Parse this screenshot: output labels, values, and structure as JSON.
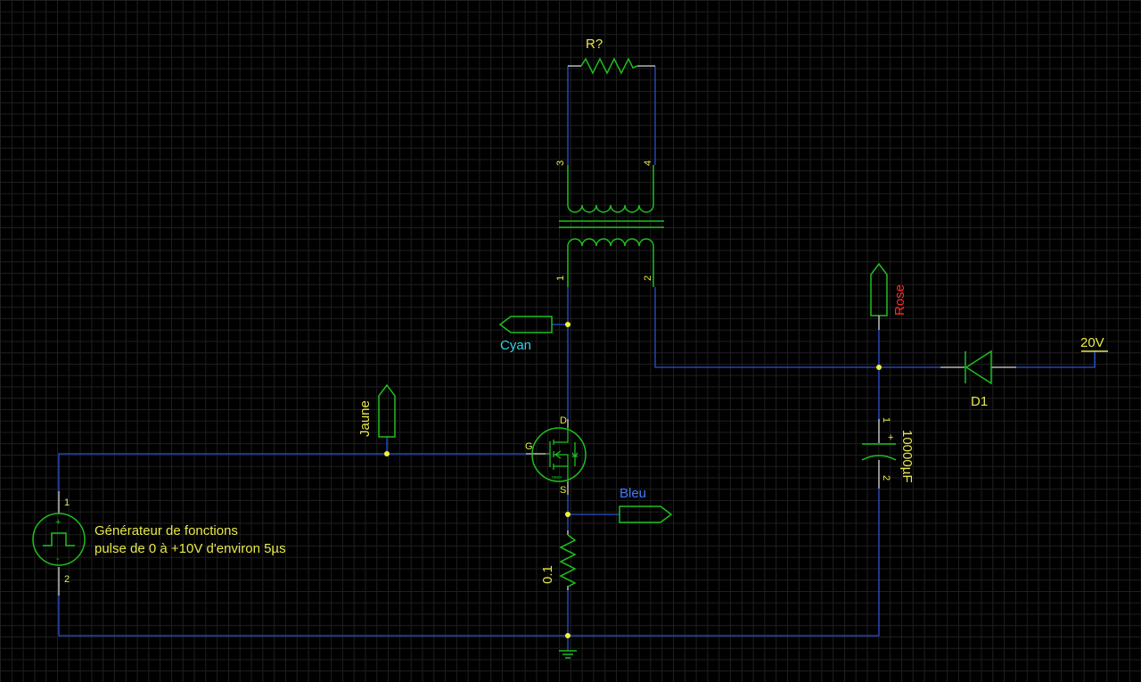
{
  "colors": {
    "background": "#000000",
    "grid": "#1f1f1f",
    "wire": "#2b4fd6",
    "component": "#1fbf1f",
    "junction": "#f2f23a",
    "text_yellow": "#e8e84a",
    "label_cyan": "#2fd6e6",
    "label_blue": "#3d7bff",
    "label_red": "#ff2a2a",
    "pin_stub": "#d8d8d8"
  },
  "components": {
    "resistor_top": {
      "ref": "R?"
    },
    "transformer": {
      "pins": [
        "1",
        "2",
        "3",
        "4"
      ]
    },
    "mosfet": {
      "pin_g": "G",
      "pin_d": "D",
      "pin_s": "S",
      "tiny_text": "nnnn"
    },
    "resistor_shunt": {
      "value": "0.1"
    },
    "capacitor": {
      "value": "10000µF",
      "pin1": "1",
      "pin2": "2",
      "plus": "+"
    },
    "diode": {
      "ref": "D1"
    },
    "generator": {
      "pin1": "1",
      "pin2": "2",
      "plus": "+",
      "minus": "-",
      "line1": "Générateur de fonctions",
      "line2": "pulse de 0 à +10V d'environ 5µs"
    }
  },
  "net_labels": {
    "cyan": "Cyan",
    "jaune": "Jaune",
    "bleu": "Bleu",
    "rose": "Rose"
  },
  "power_labels": {
    "v20": "20V"
  }
}
